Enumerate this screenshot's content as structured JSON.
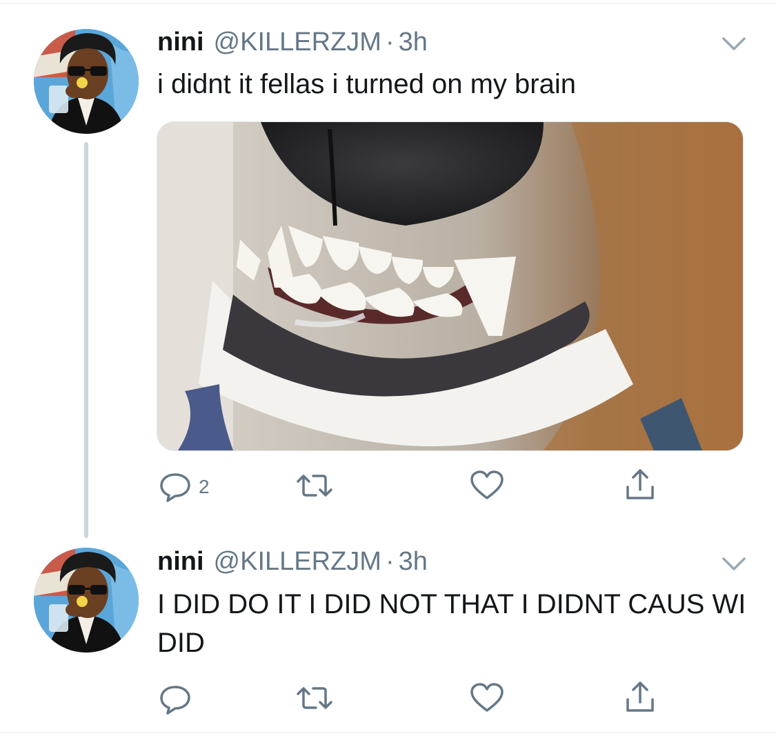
{
  "tweets": [
    {
      "name": "nini",
      "handle": "@KILLERZJM",
      "separator": "·",
      "time": "3h",
      "text": "i didnt it fellas i turned on my brain",
      "reply_count": "2",
      "has_media": true
    },
    {
      "name": "nini",
      "handle": "@KILLERZJM",
      "separator": "·",
      "time": "3h",
      "text": "I DID DO IT I DID NOT THAT I DIDNT CAUS WI DID",
      "reply_count": "",
      "has_media": false
    }
  ],
  "icons": {
    "reply": "reply-icon",
    "retweet": "retweet-icon",
    "like": "heart-icon",
    "share": "share-icon",
    "caret": "chevron-down-icon"
  },
  "colors": {
    "icon_gray": "#657786",
    "thread_line": "#ccd6dd",
    "divider": "#e6ecf0"
  }
}
